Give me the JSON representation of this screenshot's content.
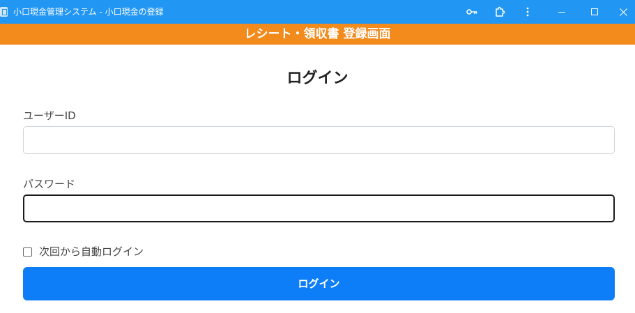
{
  "window": {
    "title": "小口現金管理システム - 小口現金の登録",
    "icons": [
      "app-icon",
      "key-icon",
      "extension-icon",
      "more-vert-icon",
      "minimize-icon",
      "maximize-icon",
      "close-icon"
    ]
  },
  "banner": {
    "text": "レシート・領収書 登録画面"
  },
  "form": {
    "title": "ログイン",
    "user_id_label": "ユーザーID",
    "user_id_value": "",
    "password_label": "パスワード",
    "password_value": "",
    "remember_label": "次回から自動ログイン",
    "remember_checked": false,
    "submit_label": "ログイン"
  },
  "colors": {
    "titlebar": "#2196f3",
    "banner": "#f28a1c",
    "primary_button": "#0d7ef7"
  }
}
